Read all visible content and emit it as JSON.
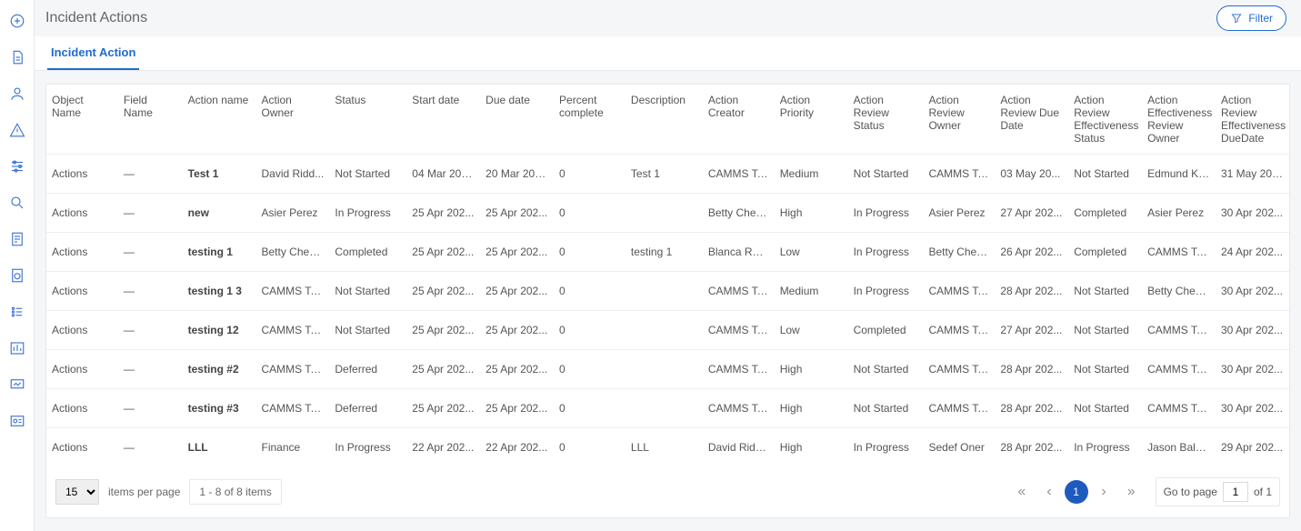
{
  "header": {
    "title": "Incident Actions",
    "filter_label": "Filter"
  },
  "tabs": [
    {
      "label": "Incident Action"
    }
  ],
  "columns": [
    "Object Name",
    "Field Name",
    "Action name",
    "Action Owner",
    "Status",
    "Start date",
    "Due date",
    "Percent complete",
    "Description",
    "Action Creator",
    "Action Priority",
    "Action Review Status",
    "Action Review Owner",
    "Action Review Due Date",
    "Action Review Effectiveness Status",
    "Action Effectiveness Review Owner",
    "Action Review Effectiveness DueDate"
  ],
  "rows": [
    {
      "object": "Actions",
      "field": "—",
      "name": "Test 1",
      "owner": "David Ridd...",
      "status": "Not Started",
      "start": "04 Mar 202...",
      "due": "20 Mar 202...",
      "pct": "0",
      "desc": "Test 1",
      "creator": "CAMMS Tes...",
      "priority": "Medium",
      "rstatus": "Not Started",
      "rowner": "CAMMS Tes...",
      "rdue": "03 May 20...",
      "effstatus": "Not Started",
      "effowner": "Edmund Kum",
      "effdue": "31 May 202..."
    },
    {
      "object": "Actions",
      "field": "—",
      "name": "new",
      "owner": "Asier Perez",
      "status": "In Progress",
      "start": "25 Apr 202...",
      "due": "25 Apr 202...",
      "pct": "0",
      "desc": "",
      "creator": "Betty Cheo...",
      "priority": "High",
      "rstatus": "In Progress",
      "rowner": "Asier Perez",
      "rdue": "27 Apr 202...",
      "effstatus": "Completed",
      "effowner": "Asier Perez",
      "effdue": "30 Apr 202..."
    },
    {
      "object": "Actions",
      "field": "—",
      "name": "testing 1",
      "owner": "Betty Cheo...",
      "status": "Completed",
      "start": "25 Apr 202...",
      "due": "25 Apr 202...",
      "pct": "0",
      "desc": "testing 1",
      "creator": "Blanca Rod...",
      "priority": "Low",
      "rstatus": "In Progress",
      "rowner": "Betty Cheo...",
      "rdue": "26 Apr 202...",
      "effstatus": "Completed",
      "effowner": "CAMMS Tes...",
      "effdue": "24 Apr 202..."
    },
    {
      "object": "Actions",
      "field": "—",
      "name": "testing 1 3",
      "owner": "CAMMS Tes...",
      "status": "Not Started",
      "start": "25 Apr 202...",
      "due": "25 Apr 202...",
      "pct": "0",
      "desc": "",
      "creator": "CAMMS Tes...",
      "priority": "Medium",
      "rstatus": "In Progress",
      "rowner": "CAMMS Tes...",
      "rdue": "28 Apr 202...",
      "effstatus": "Not Started",
      "effowner": "Betty Cheo...",
      "effdue": "30 Apr 202..."
    },
    {
      "object": "Actions",
      "field": "—",
      "name": "testing 12",
      "owner": "CAMMS Tes...",
      "status": "Not Started",
      "start": "25 Apr 202...",
      "due": "25 Apr 202...",
      "pct": "0",
      "desc": "",
      "creator": "CAMMS Tes...",
      "priority": "Low",
      "rstatus": "Completed",
      "rowner": "CAMMS Tes...",
      "rdue": "27 Apr 202...",
      "effstatus": "Not Started",
      "effowner": "CAMMS Tes...",
      "effdue": "30 Apr 202..."
    },
    {
      "object": "Actions",
      "field": "—",
      "name": "testing #2",
      "owner": "CAMMS Tes...",
      "status": "Deferred",
      "start": "25 Apr 202...",
      "due": "25 Apr 202...",
      "pct": "0",
      "desc": "",
      "creator": "CAMMS Tes...",
      "priority": "High",
      "rstatus": "Not Started",
      "rowner": "CAMMS Tes...",
      "rdue": "28 Apr 202...",
      "effstatus": "Not Started",
      "effowner": "CAMMS Tes...",
      "effdue": "30 Apr 202..."
    },
    {
      "object": "Actions",
      "field": "—",
      "name": "testing #3",
      "owner": "CAMMS Tes...",
      "status": "Deferred",
      "start": "25 Apr 202...",
      "due": "25 Apr 202...",
      "pct": "0",
      "desc": "",
      "creator": "CAMMS Tes...",
      "priority": "High",
      "rstatus": "Not Started",
      "rowner": "CAMMS Tes...",
      "rdue": "28 Apr 202...",
      "effstatus": "Not Started",
      "effowner": "CAMMS Tes...",
      "effdue": "30 Apr 202..."
    },
    {
      "object": "Actions",
      "field": "—",
      "name": "LLL",
      "owner": "Finance",
      "status": "In Progress",
      "start": "22 Apr 202...",
      "due": "22 Apr 202...",
      "pct": "0",
      "desc": "LLL",
      "creator": "David Ridd...",
      "priority": "High",
      "rstatus": "In Progress",
      "rowner": "Sedef Oner",
      "rdue": "28 Apr 202...",
      "effstatus": "In Progress",
      "effowner": "Jason Baldrey",
      "effdue": "29 Apr 202..."
    }
  ],
  "pager": {
    "page_size": "15",
    "items_label": "items per page",
    "range": "1 - 8 of 8 items",
    "current_page": "1",
    "goto_label": "Go to page",
    "goto_value": "1",
    "of_label": "of 1"
  }
}
